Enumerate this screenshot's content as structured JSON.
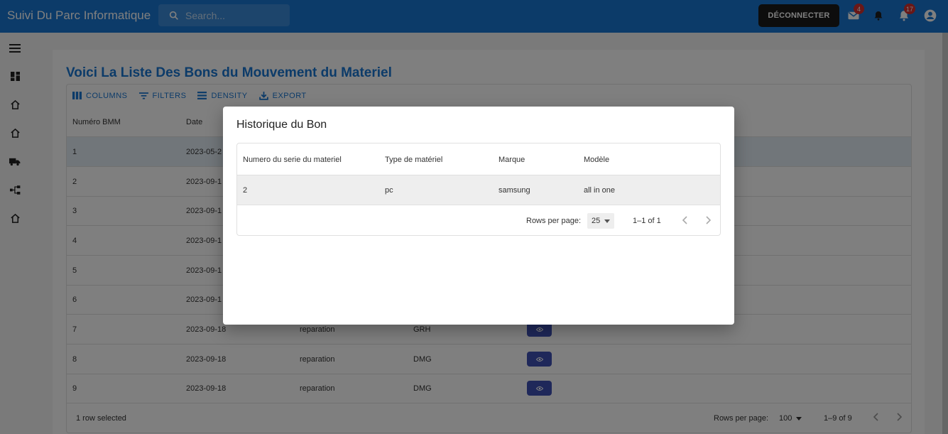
{
  "app": {
    "title": "Suivi Du Parc Informatique"
  },
  "search": {
    "placeholder": "Search..."
  },
  "header": {
    "logout_label": "DÉCONNECTER",
    "mail_badge": "4",
    "notif_badge": "17"
  },
  "page": {
    "title": "Voici La Liste Des Bons du Mouvement du Materiel"
  },
  "toolbar": {
    "columns": "COLUMNS",
    "filters": "FILTERS",
    "density": "DENSITY",
    "export": "EXPORT"
  },
  "grid": {
    "columns": [
      "Numéro BMM",
      "Date"
    ],
    "rows": [
      {
        "num": "1",
        "date": "2023-05-2",
        "motif": "",
        "service": ""
      },
      {
        "num": "2",
        "date": "2023-09-1",
        "motif": "",
        "service": ""
      },
      {
        "num": "3",
        "date": "2023-09-1",
        "motif": "",
        "service": ""
      },
      {
        "num": "4",
        "date": "2023-09-1",
        "motif": "",
        "service": ""
      },
      {
        "num": "5",
        "date": "2023-09-1",
        "motif": "",
        "service": ""
      },
      {
        "num": "6",
        "date": "2023-09-1",
        "motif": "",
        "service": ""
      },
      {
        "num": "7",
        "date": "2023-09-18",
        "motif": "reparation",
        "service": "GRH"
      },
      {
        "num": "8",
        "date": "2023-09-18",
        "motif": "reparation",
        "service": "DMG"
      },
      {
        "num": "9",
        "date": "2023-09-18",
        "motif": "reparation",
        "service": "DMG"
      }
    ],
    "footer": {
      "selected": "1 row selected",
      "rows_per_page_label": "Rows per page:",
      "rows_per_page": "100",
      "range": "1–9 of 9"
    }
  },
  "modal": {
    "title": "Historique du Bon",
    "columns": [
      "Numero du serie du materiel",
      "Type de matériel",
      "Marque",
      "Modèle"
    ],
    "row": {
      "serie": "2",
      "type": "pc",
      "marque": "samsung",
      "modele": "all in one"
    },
    "footer": {
      "rows_per_page_label": "Rows per page:",
      "rows_per_page": "25",
      "range": "1–1 of 1"
    }
  }
}
